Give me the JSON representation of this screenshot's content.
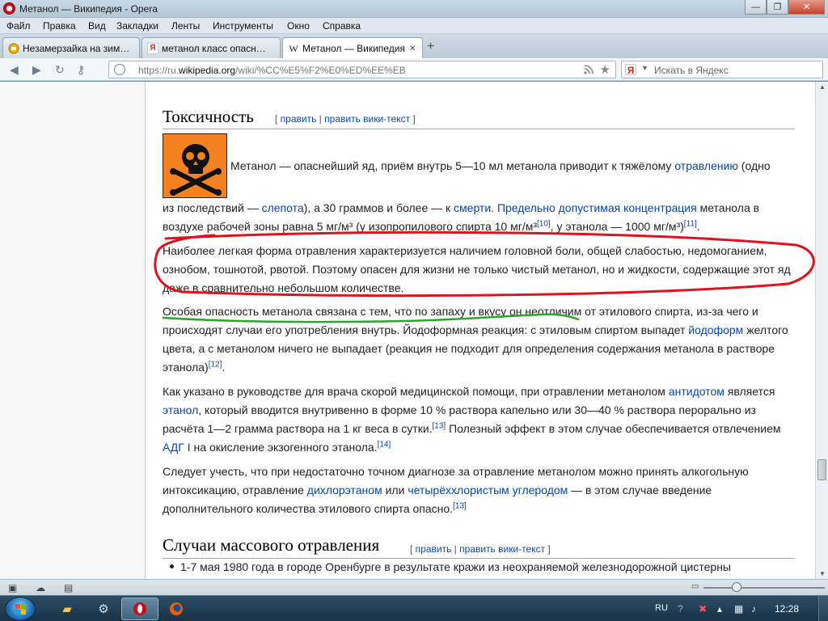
{
  "window": {
    "title": "Метанол — Википедия - Opera",
    "controls": {
      "minimize": "—",
      "maximize": "❐",
      "close": "✕"
    }
  },
  "menubar": {
    "items": [
      "Файл",
      "Правка",
      "Вид",
      "Закладки",
      "Ленты",
      "Инструменты",
      "Окно",
      "Справка"
    ]
  },
  "tabs": [
    {
      "label": "Незамерзайка на зим…",
      "icon": "page-icon",
      "active": false
    },
    {
      "label": "метанол класс опасн…",
      "icon": "yandex-icon",
      "active": false
    },
    {
      "label": "Метанол — Википедия",
      "icon": "wikipedia-icon",
      "active": true
    }
  ],
  "new_tab": "+",
  "address": {
    "url_prefix": "https://ru.",
    "url_host": "wikipedia.org",
    "url_path": "/wiki/%CC%E5%F2%E0%ED%EE%EB",
    "search_placeholder": "Искать в Яндекс",
    "search_engine_letter": "Я"
  },
  "article": {
    "toxicity_heading": "Токсичность",
    "edit_label": "править",
    "edit_source_label": "править вики-текст",
    "para1_a": "Метанол — опаснейший яд, приём внутрь 5—10 мл метанола приводит к тяжёлому ",
    "para1_link1": "отравлению",
    "para1_b": " (одно",
    "para1_c": "из последствий — ",
    "para1_link2": "слепота",
    "para1_d": "), а 30 граммов и более — к ",
    "para1_link3": "смерти",
    "para1_e": ". ",
    "para1_link4": "Предельно допустимая концентрация",
    "para1_f": " метанола в",
    "para1_g": "воздухе рабочей зоны равна 5 мг/м³ (у изопропилового спирта 10 мг/м³",
    "ref10": "[10]",
    "para1_h": ", у этанола — 1000 мг/м³)",
    "ref11": "[11]",
    "para1_i": ".",
    "para2": "Наиболее легкая форма отравления характеризуется наличием головной боли, общей слабостью, недомоганием, ознобом, тошнотой, рвотой. Поэтому опасен для жизни не только чистый метанол, но и жидкости, содержащие этот яд даже в сравнительно небольшом количестве.",
    "para3_a": "Особая опасность метанола связана с тем, что по запаху и вкусу он неотличим от этилового спирта, из-за чего и происходят случаи его употребления внутрь. Йодоформная реакция: с этиловым спиртом выпадет ",
    "para3_link": "йодоформ",
    "para3_b": " желтого цвета, а с метанолом ничего не выпадает (реакция не подходит для определения содержания метанола в растворе этанола)",
    "ref12": "[12]",
    "para3_c": ".",
    "para4_a": "Как указано в руководстве для врача скорой медицинской помощи, при отравлении метанолом ",
    "para4_link1": "антидотом",
    "para4_b": " является ",
    "para4_link2": "этанол",
    "para4_c": ", который вводится внутривенно в форме 10 % раствора капельно или 30—40 % раствора перорально из расчёта 1—2 грамма раствора на 1 кг веса в сутки.",
    "ref13": "[13]",
    "para4_d": " Полезный эффект в этом случае обеспечивается отвлечением ",
    "para4_link3": "АДГ I",
    "para4_e": " на окисление экзогенного этанола.",
    "ref14": "[14]",
    "para5_a": "Следует учесть, что при недостаточно точном диагнозе за отравление метанолом можно принять алкогольную интоксикацию, отравление ",
    "para5_link1": "дихлорэтаном",
    "para5_b": " или ",
    "para5_link2": "четырёххлористым углеродом",
    "para5_c": " — в этом случае введение дополнительного количества этилового спирта опасно.",
    "ref13b": "[13]",
    "mass_heading": "Случаи массового отравления",
    "bullet1": "1-7 мая 1980 года в городе Оренбурге в результате кражи из неохраняемой железнодорожной цистерны"
  },
  "taskbar": {
    "lang": "RU",
    "clock": "12:28"
  },
  "colors": {
    "accent_link": "#0645ad",
    "hazard_orange": "#f58220",
    "annotation_red": "#e0121e",
    "annotation_green": "#2ca52c"
  }
}
